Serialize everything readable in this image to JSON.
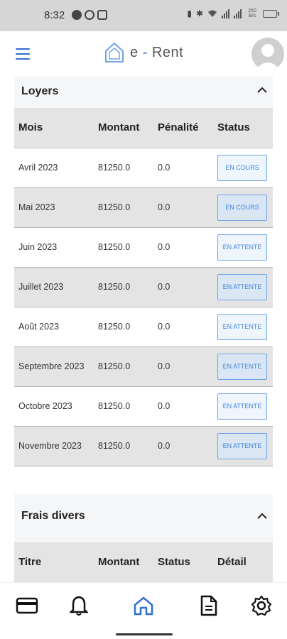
{
  "statusbar": {
    "time": "8:32",
    "network_label": "250 B/s"
  },
  "app": {
    "logo_text_left": "e",
    "logo_dash": "-",
    "logo_text_right": "Rent"
  },
  "loyers": {
    "title": "Loyers",
    "columns": [
      "Mois",
      "Montant",
      "Pénalité",
      "Status"
    ],
    "rows": [
      {
        "mois": "Avril 2023",
        "montant": "81250.0",
        "penalite": "0.0",
        "status": "EN COURS"
      },
      {
        "mois": "Mai 2023",
        "montant": "81250.0",
        "penalite": "0.0",
        "status": "EN COURS"
      },
      {
        "mois": "Juin 2023",
        "montant": "81250.0",
        "penalite": "0.0",
        "status": "EN ATTENTE"
      },
      {
        "mois": "Juillet 2023",
        "montant": "81250.0",
        "penalite": "0.0",
        "status": "EN ATTENTE"
      },
      {
        "mois": "Août 2023",
        "montant": "81250.0",
        "penalite": "0.0",
        "status": "EN ATTENTE"
      },
      {
        "mois": "Septembre 2023",
        "montant": "81250.0",
        "penalite": "0.0",
        "status": "EN ATTENTE"
      },
      {
        "mois": "Octobre 2023",
        "montant": "81250.0",
        "penalite": "0.0",
        "status": "EN ATTENTE"
      },
      {
        "mois": "Novembre 2023",
        "montant": "81250.0",
        "penalite": "0.0",
        "status": "EN ATTENTE"
      }
    ]
  },
  "frais": {
    "title": "Frais divers",
    "columns": [
      "Titre",
      "Montant",
      "Status",
      "Détail"
    ]
  },
  "nav": {
    "items": [
      {
        "icon": "credit-card-icon"
      },
      {
        "icon": "bell-icon"
      },
      {
        "icon": "home-icon",
        "active": true
      },
      {
        "icon": "document-icon"
      },
      {
        "icon": "settings-icon"
      }
    ]
  },
  "colors": {
    "accent": "#2f6fd6",
    "status_border": "#6fa5e6",
    "header_bg": "#e4e4e4"
  }
}
